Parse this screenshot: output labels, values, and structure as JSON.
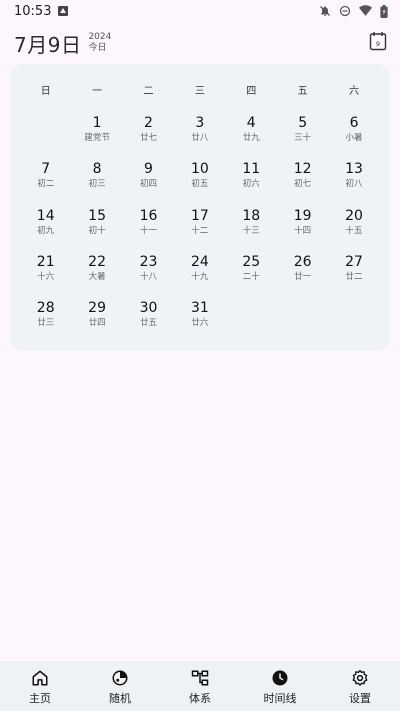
{
  "status_bar": {
    "time": "10:53",
    "icons": [
      "notifications-off-icon",
      "do-not-disturb-icon",
      "wifi-icon",
      "battery-icon"
    ]
  },
  "header": {
    "date": "7月9日",
    "year": "2024",
    "today_label": "今日",
    "calendar_icon_day": "9"
  },
  "calendar": {
    "weekdays": [
      "日",
      "一",
      "二",
      "三",
      "四",
      "五",
      "六"
    ],
    "leading_empty": 1,
    "days": [
      {
        "num": "1",
        "sub": "建党节"
      },
      {
        "num": "2",
        "sub": "廿七"
      },
      {
        "num": "3",
        "sub": "廿八"
      },
      {
        "num": "4",
        "sub": "廿九"
      },
      {
        "num": "5",
        "sub": "三十"
      },
      {
        "num": "6",
        "sub": "小暑"
      },
      {
        "num": "7",
        "sub": "初二"
      },
      {
        "num": "8",
        "sub": "初三"
      },
      {
        "num": "9",
        "sub": "初四"
      },
      {
        "num": "10",
        "sub": "初五"
      },
      {
        "num": "11",
        "sub": "初六"
      },
      {
        "num": "12",
        "sub": "初七"
      },
      {
        "num": "13",
        "sub": "初八"
      },
      {
        "num": "14",
        "sub": "初九"
      },
      {
        "num": "15",
        "sub": "初十"
      },
      {
        "num": "16",
        "sub": "十一"
      },
      {
        "num": "17",
        "sub": "十二"
      },
      {
        "num": "18",
        "sub": "十三"
      },
      {
        "num": "19",
        "sub": "十四"
      },
      {
        "num": "20",
        "sub": "十五"
      },
      {
        "num": "21",
        "sub": "十六"
      },
      {
        "num": "22",
        "sub": "大暑"
      },
      {
        "num": "23",
        "sub": "十八"
      },
      {
        "num": "24",
        "sub": "十九"
      },
      {
        "num": "25",
        "sub": "二十"
      },
      {
        "num": "26",
        "sub": "廿一"
      },
      {
        "num": "27",
        "sub": "廿二"
      },
      {
        "num": "28",
        "sub": "廿三"
      },
      {
        "num": "29",
        "sub": "廿四"
      },
      {
        "num": "30",
        "sub": "廿五"
      },
      {
        "num": "31",
        "sub": "廿六"
      }
    ]
  },
  "nav": {
    "items": [
      {
        "label": "主页",
        "icon": "home-icon"
      },
      {
        "label": "随机",
        "icon": "random-icon"
      },
      {
        "label": "体系",
        "icon": "hierarchy-icon"
      },
      {
        "label": "时间线",
        "icon": "clock-icon"
      },
      {
        "label": "设置",
        "icon": "gear-icon"
      }
    ]
  }
}
